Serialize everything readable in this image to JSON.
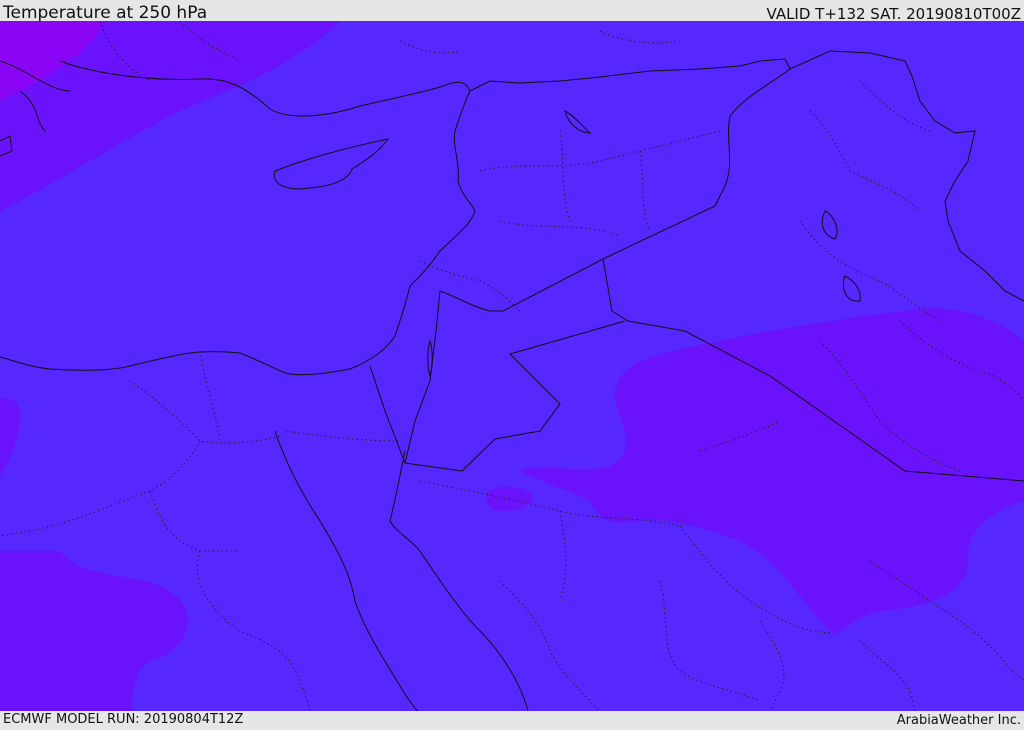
{
  "header": {
    "title": "Temperature at 250 hPa",
    "valid": "VALID T+132 SAT. 20190810T00Z"
  },
  "footer": {
    "model_run": "ECMWF MODEL RUN: 20190804T12Z",
    "brand": "ArabiaWeather Inc."
  },
  "colors": {
    "base": "#5627fe",
    "colder": "#6a12fb",
    "coldest": "#8a05f6",
    "bar": "#e6e6e6",
    "border": "#111111"
  }
}
